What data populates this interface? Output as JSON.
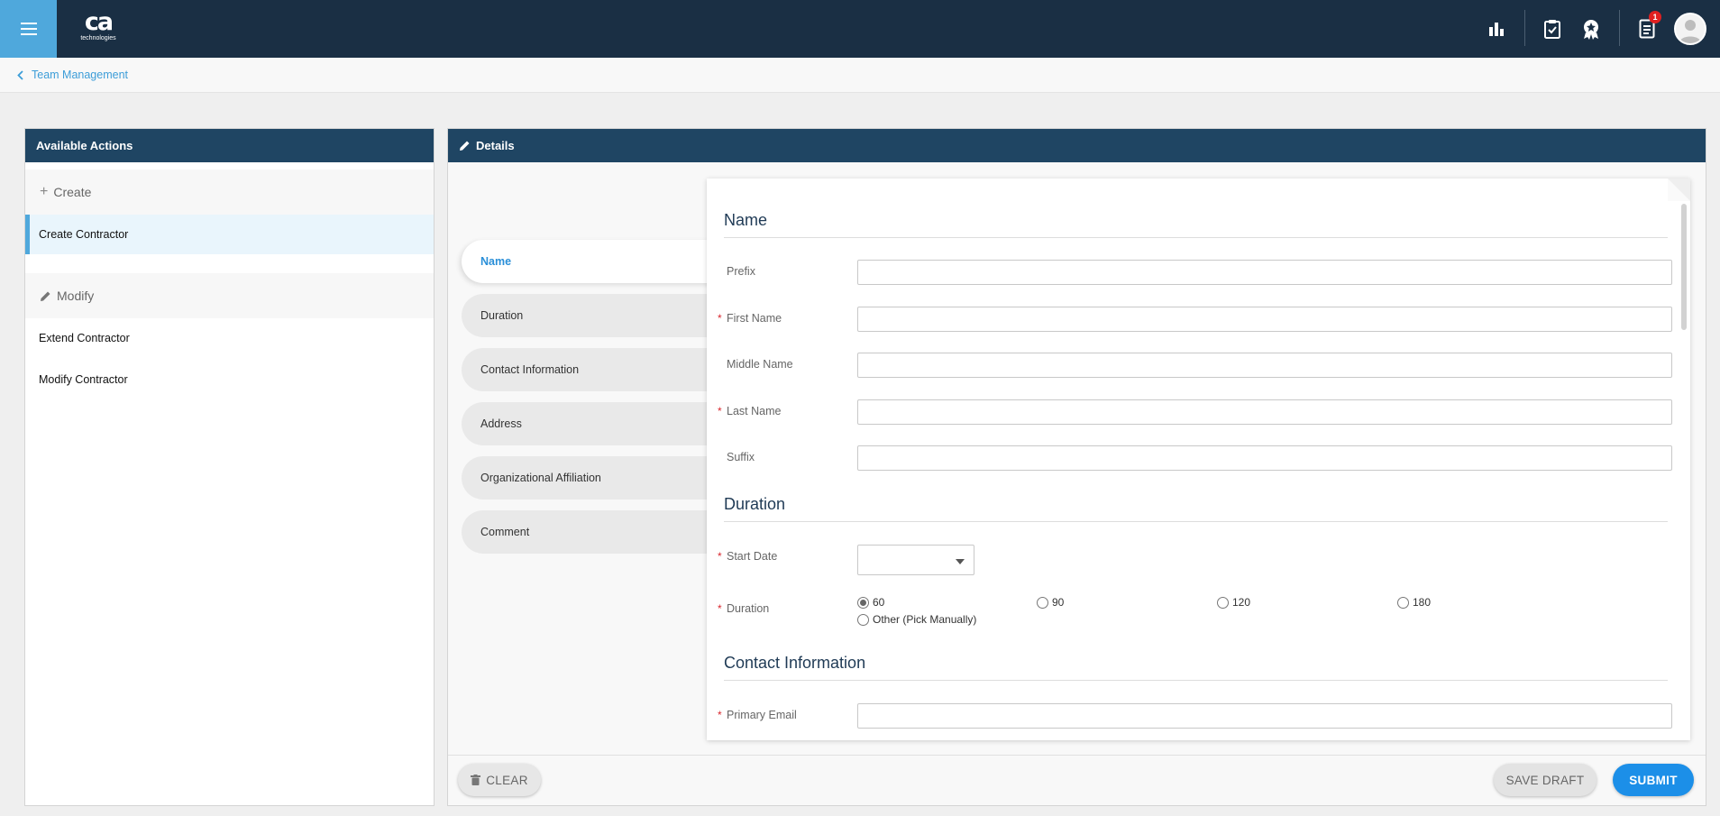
{
  "header": {
    "logo_text": "ca",
    "logo_subtext": "technologies",
    "notification_count": "1",
    "icons": [
      "menu-icon",
      "bar-chart-icon",
      "clipboard-check-icon",
      "award-badge-icon",
      "document-icon",
      "user-avatar-icon"
    ],
    "colors": {
      "topbar": "#1a2f44",
      "menu_button": "#4fa8dc",
      "panel_header": "#1f4563",
      "accent": "#1c8fe8",
      "required": "#d9272e"
    }
  },
  "breadcrumb": {
    "label": "Team Management"
  },
  "left_panel": {
    "title": "Available Actions",
    "sections": [
      {
        "label": "Create",
        "items": [
          "Create Contractor"
        ]
      },
      {
        "label": "Modify",
        "items": [
          "Extend Contractor",
          "Modify Contractor"
        ]
      }
    ]
  },
  "right_panel": {
    "title": "Details",
    "steps": [
      "Name",
      "Duration",
      "Contact Information",
      "Address",
      "Organizational Affiliation",
      "Comment"
    ],
    "active_step": "Name"
  },
  "form": {
    "name_section": {
      "title": "Name",
      "fields": [
        {
          "label": "Prefix",
          "required": false,
          "value": ""
        },
        {
          "label": "First Name",
          "required": true,
          "value": ""
        },
        {
          "label": "Middle Name",
          "required": false,
          "value": ""
        },
        {
          "label": "Last Name",
          "required": true,
          "value": ""
        },
        {
          "label": "Suffix",
          "required": false,
          "value": ""
        }
      ]
    },
    "duration_section": {
      "title": "Duration",
      "start_date_label": "Start Date",
      "start_date_value": "",
      "duration_label": "Duration",
      "options": [
        "60",
        "90",
        "120",
        "180",
        "Other (Pick Manually)"
      ],
      "selected": "60"
    },
    "contact_section": {
      "title": "Contact Information",
      "primary_email_label": "Primary Email",
      "primary_email_value": ""
    },
    "required_marker": "*"
  },
  "footer": {
    "clear_label": "CLEAR",
    "save_draft_label": "SAVE DRAFT",
    "submit_label": "SUBMIT"
  }
}
